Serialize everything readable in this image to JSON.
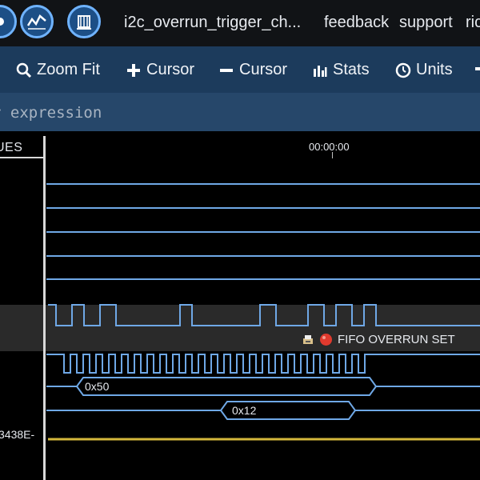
{
  "topbar": {
    "title": "i2c_overrun_trigger_ch...",
    "links": [
      "feedback",
      "support",
      "ric"
    ],
    "icons": [
      "generic-app-icon",
      "waveform-graph-icon",
      "building-icon"
    ]
  },
  "toolbar": {
    "zoom_fit": "Zoom Fit",
    "add_cursor": "Cursor",
    "remove_cursor": "Cursor",
    "stats": "Stats",
    "units": "Units"
  },
  "expression": {
    "placeholder": "r expression"
  },
  "columns": {
    "values_header": "UES"
  },
  "timeline": {
    "time_label": "00:00:00"
  },
  "annotation": {
    "text": "FIFO OVERRUN SET"
  },
  "bus_values": [
    "0x50",
    "0x12"
  ],
  "left_values": {
    "analog_value": "3438E-"
  },
  "colors": {
    "wave": "#6fa8e6",
    "analog": "#d4b83c",
    "toolbar_bg": "#1c3b5c",
    "expr_bg": "#26476a",
    "alert": "#e03a2e"
  }
}
